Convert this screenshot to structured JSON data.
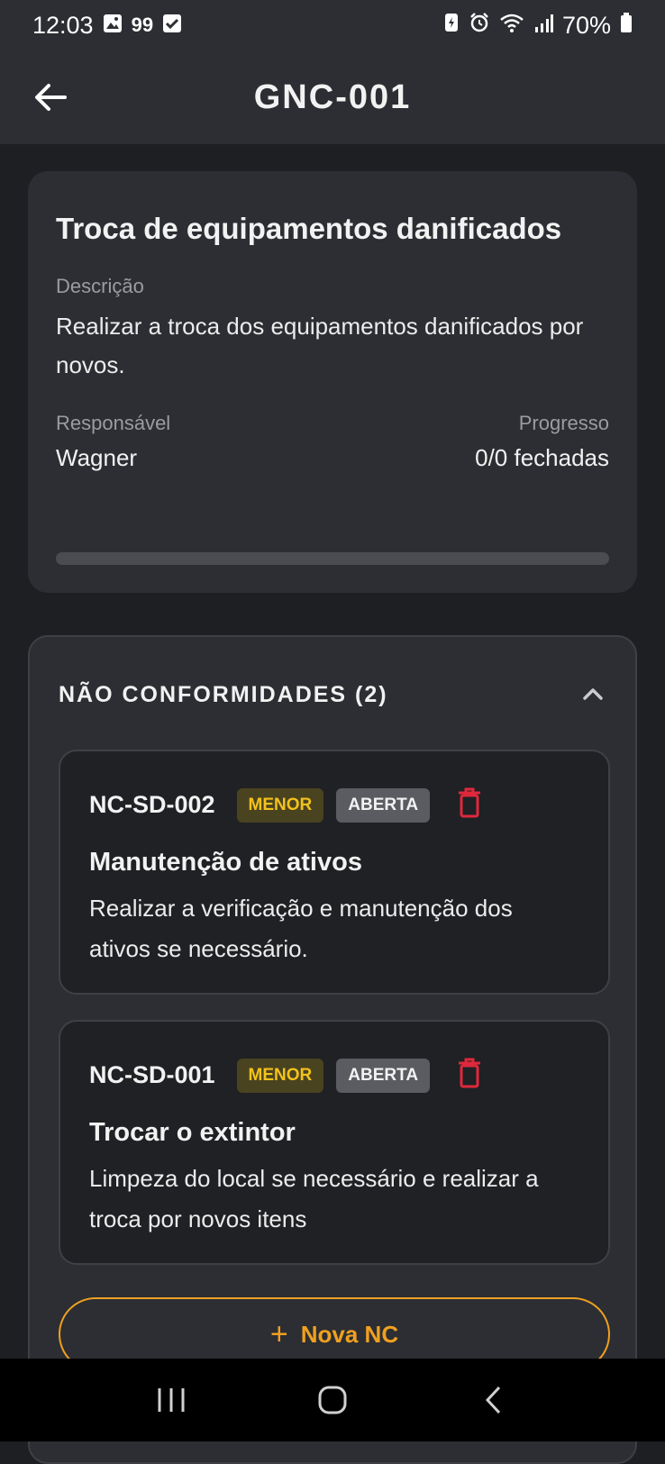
{
  "status_bar": {
    "time": "12:03",
    "notif_badge": "99",
    "battery": "70%"
  },
  "app_bar": {
    "title": "GNC-001"
  },
  "task": {
    "title": "Troca de equipamentos danificados",
    "description_label": "Descrição",
    "description": "Realizar a troca dos equipamentos danificados por novos.",
    "responsible_label": "Responsável",
    "responsible": "Wagner",
    "progress_label": "Progresso",
    "progress_text": "0/0 fechadas",
    "progress_value": 0
  },
  "nc_section": {
    "title": "NÃO CONFORMIDADES (2)",
    "items": [
      {
        "code": "NC-SD-002",
        "severity": "MENOR",
        "status": "ABERTA",
        "title": "Manutenção de ativos",
        "description": "Realizar a verificação e manutenção dos ativos se necessário."
      },
      {
        "code": "NC-SD-001",
        "severity": "MENOR",
        "status": "ABERTA",
        "title": "Trocar o extintor",
        "description": "Limpeza do local se necessário e realizar a troca por novos itens"
      }
    ],
    "new_button": {
      "plus": "+",
      "label": "Nova NC"
    }
  },
  "colors": {
    "background": "#1d1f22",
    "surface": "#2c2e33",
    "accent": "#f0a020",
    "severity_text": "#f4c21b",
    "danger": "#e0283c"
  },
  "icons": {
    "back": "arrow-left",
    "collapse": "chevron-up",
    "delete": "trash",
    "nav_recents": "recents",
    "nav_home": "home",
    "nav_back": "back"
  }
}
